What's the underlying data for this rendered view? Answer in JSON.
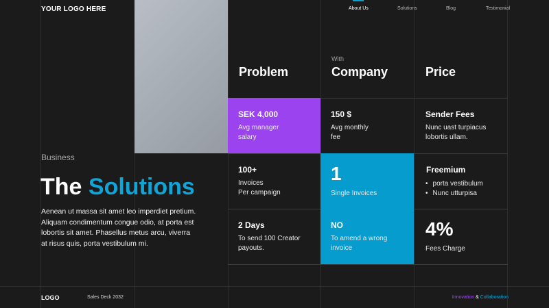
{
  "header": {
    "logo": "YOUR LOGO HERE",
    "nav": [
      {
        "label": "About Us",
        "active": true
      },
      {
        "label": "Solutions",
        "active": false
      },
      {
        "label": "Blog",
        "active": false
      },
      {
        "label": "Testimonial",
        "active": false
      }
    ]
  },
  "hero": {
    "kicker": "Business",
    "title_part1": "The",
    "title_part2": "Solutions",
    "body": "Aenean ut massa sit amet leo imperdiet pretium. Aliquam condimentum congue odio, at porta est lobortis sit amet. Phasellus metus arcu, viverra at risus quis, porta vestibulum mi."
  },
  "table": {
    "columns": [
      {
        "title": "Problem",
        "subtitle": ""
      },
      {
        "title": "Company",
        "subtitle": "With"
      },
      {
        "title": "Price",
        "subtitle": ""
      }
    ],
    "row1": [
      {
        "title": "SEK 4,000",
        "desc": "Avg manager\nsalary"
      },
      {
        "title": "150 $",
        "desc": "Avg monthly\nfee"
      },
      {
        "title": "Sender Fees",
        "desc": "Nunc uast turpiacus\nlobortis ullam."
      }
    ],
    "row2": [
      {
        "title": "100+",
        "desc": "Invoices\nPer campaign"
      },
      {
        "big": "1",
        "desc": "Single Invoices"
      },
      {
        "title": "Freemium",
        "bullets": [
          "porta vestibulum",
          "Nunc utturpisa"
        ]
      }
    ],
    "row3": [
      {
        "title": "2 Days",
        "desc": "To send 100 Creator\npayouts."
      },
      {
        "title": "NO",
        "desc": "To amend a wrong\ninvoice"
      },
      {
        "big": "4%",
        "desc": "Fees Charge"
      }
    ]
  },
  "footer": {
    "logo": "LOGO",
    "deck": "Sales Deck 2032",
    "tag_part1": "Innovation",
    "tag_amp": " & ",
    "tag_part2": "Collaboration"
  },
  "colors": {
    "background": "#1b1b1c",
    "purple": "#9a43ef",
    "blue": "#069ccd",
    "accent_text": "#11a4d6"
  }
}
